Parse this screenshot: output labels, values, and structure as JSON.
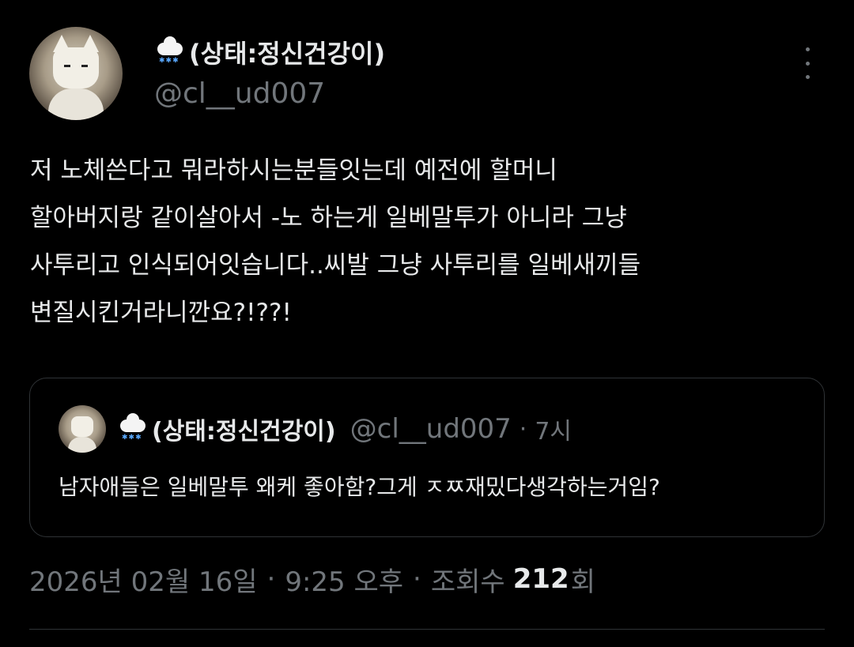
{
  "author": {
    "display_name": "(상태:정신건강이)",
    "handle": "@cl__ud007",
    "status_icon": "cloud-with-snow-icon",
    "avatar_icon": "cat-avatar"
  },
  "tweet": {
    "lines": [
      "저 노체쓴다고 뭐라하시는분들잇는데 예전에 할머니",
      "할아버지랑 같이살아서 -노 하는게 일베말투가 아니라 그냥",
      "사투리고 인식되어잇습니다..씨발 그냥 사투리를 일베새끼들",
      "변질시킨거라니깐요?!??!"
    ]
  },
  "quote": {
    "display_name": "(상태:정신건강이)",
    "handle": "@cl__ud007",
    "separator": "·",
    "time": "7시",
    "text": "남자애들은 일베말투 왜케 좋아함?그게 ㅈㅉ재밌다생각하는거임?"
  },
  "meta": {
    "date": "2026년 02월 16일",
    "separator": "·",
    "time": "9:25 오후",
    "views_label": "조회수",
    "views_count": "212",
    "views_unit": "회"
  },
  "colors": {
    "background": "#000000",
    "text_primary": "#e7e9ea",
    "text_secondary": "#71767b",
    "border": "#2f3336"
  }
}
